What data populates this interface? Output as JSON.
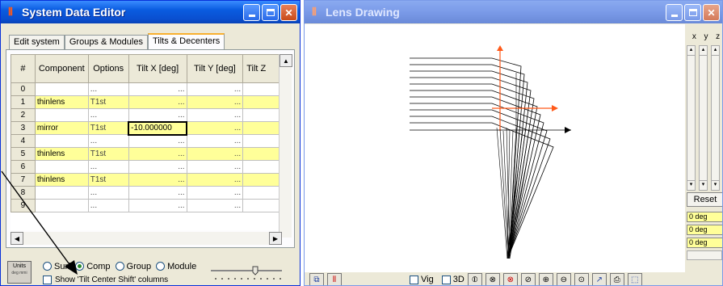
{
  "left_window": {
    "title": "System Data Editor",
    "app_icon": "lens-app-icon",
    "tabs": [
      {
        "label": "Edit system",
        "active": false
      },
      {
        "label": "Groups & Modules",
        "active": false
      },
      {
        "label": "Tilts & Decenters",
        "active": true
      }
    ],
    "columns": [
      "#",
      "Component",
      "Options",
      "Tilt X [deg]",
      "Tilt Y [deg]",
      "Tilt Z"
    ],
    "rows": [
      {
        "num": "0",
        "component": "",
        "options": "...",
        "tiltx": "...",
        "tilty": "...",
        "yellow": false
      },
      {
        "num": "1",
        "component": "thinlens",
        "options": "T1st",
        "tiltx": "...",
        "tilty": "...",
        "yellow": true
      },
      {
        "num": "2",
        "component": "",
        "options": "...",
        "tiltx": "...",
        "tilty": "...",
        "yellow": false
      },
      {
        "num": "3",
        "component": "mirror",
        "options": "T1st",
        "tiltx": "-10.000000",
        "tilty": "...",
        "yellow": true
      },
      {
        "num": "4",
        "component": "",
        "options": "...",
        "tiltx": "...",
        "tilty": "...",
        "yellow": false
      },
      {
        "num": "5",
        "component": "thinlens",
        "options": "T1st",
        "tiltx": "...",
        "tilty": "...",
        "yellow": true
      },
      {
        "num": "6",
        "component": "",
        "options": "...",
        "tiltx": "...",
        "tilty": "...",
        "yellow": false
      },
      {
        "num": "7",
        "component": "thinlens",
        "options": "T1st",
        "tiltx": "...",
        "tilty": "...",
        "yellow": true
      },
      {
        "num": "8",
        "component": "",
        "options": "...",
        "tiltx": "...",
        "tilty": "...",
        "yellow": false
      },
      {
        "num": "9",
        "component": "",
        "options": "...",
        "tiltx": "...",
        "tilty": "...",
        "yellow": false
      }
    ],
    "units_button": {
      "label": "Units",
      "sub": "deg mmi"
    },
    "radio_options": [
      {
        "label": "Surf",
        "selected": false
      },
      {
        "label": "Comp",
        "selected": true
      },
      {
        "label": "Group",
        "selected": false
      },
      {
        "label": "Module",
        "selected": false
      }
    ],
    "checkbox_label": "Show 'Tilt Center Shift' columns"
  },
  "right_window": {
    "title": "Lens Drawing",
    "axis_labels": [
      "x",
      "y",
      "z"
    ],
    "reset_label": "Reset",
    "deg_values": [
      "0 deg",
      "0 deg",
      "0 deg"
    ],
    "toolbar": {
      "vig_label": "Vig",
      "threed_label": "3D"
    }
  },
  "colors": {
    "title_active": "#0a5ce0",
    "title_inactive": "#7a9ae8",
    "highlight_row": "#ffff99",
    "ray_axis": "#ff5a1a"
  }
}
